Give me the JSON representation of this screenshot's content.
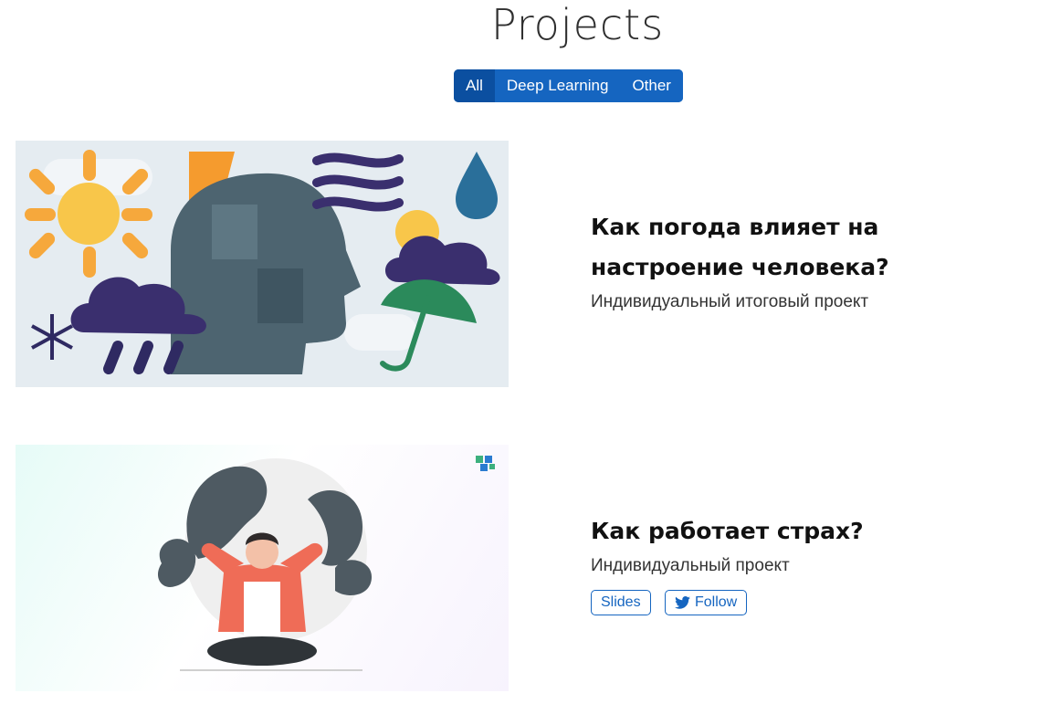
{
  "page": {
    "title": "Projects"
  },
  "filters": [
    {
      "label": "All",
      "active": true
    },
    {
      "label": "Deep Learning",
      "active": false
    },
    {
      "label": "Other",
      "active": false
    }
  ],
  "projects": [
    {
      "title": "Как погода влияет на настроение человека?",
      "subtitle": "Индивидуальный итоговый проект",
      "image_icon": "weather-mood-illustration"
    },
    {
      "title": "Как работает страх?",
      "subtitle": "Индивидуальный проект",
      "image_icon": "fear-illustration",
      "buttons": [
        {
          "label": "Slides"
        },
        {
          "label": "Follow",
          "icon": "twitter-icon"
        }
      ]
    }
  ],
  "colors": {
    "accent": "#1565c0",
    "accent_active": "#0b4fa0"
  }
}
